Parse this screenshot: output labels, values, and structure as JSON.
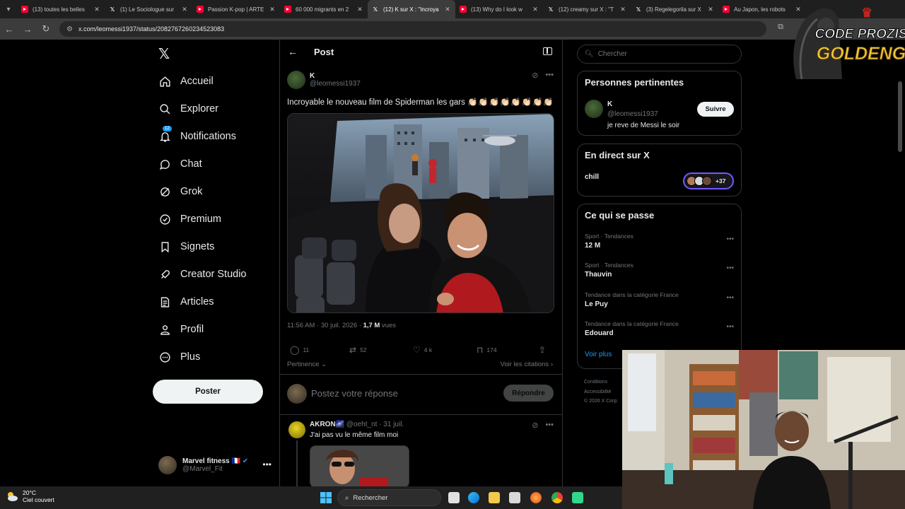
{
  "browser": {
    "tabs": [
      {
        "favicon": "youtube-icon",
        "title": "(13) toutes les belles"
      },
      {
        "favicon": "x-icon",
        "title": "(1) Le Sociologue sur"
      },
      {
        "favicon": "youtube-icon",
        "title": "Passion K-pop | ARTE"
      },
      {
        "favicon": "youtube-icon",
        "title": "60 000 migrants en 2"
      },
      {
        "favicon": "x-icon",
        "title": "(12) K sur X : \"Incroya",
        "active": true
      },
      {
        "favicon": "youtube-icon",
        "title": "(13) Why do I look w"
      },
      {
        "favicon": "x-icon",
        "title": "(12) creamy sur X : \"T"
      },
      {
        "favicon": "x-icon",
        "title": "(3) Regelegorila sur X"
      },
      {
        "favicon": "youtube-icon",
        "title": "Au Japon, les robots"
      }
    ],
    "url": "x.com/leomessi1937/status/2082767260234523083"
  },
  "overlay": {
    "logo_line1": "CODE PROZIS",
    "logo_line2": "GOLDENG"
  },
  "nav": {
    "items": [
      {
        "icon": "home-icon",
        "label": "Accueil"
      },
      {
        "icon": "search-icon",
        "label": "Explorer"
      },
      {
        "icon": "bell-icon",
        "label": "Notifications",
        "badge": "12"
      },
      {
        "icon": "chat-icon",
        "label": "Chat"
      },
      {
        "icon": "grok-icon",
        "label": "Grok"
      },
      {
        "icon": "premium-icon",
        "label": "Premium"
      },
      {
        "icon": "bookmark-icon",
        "label": "Signets"
      },
      {
        "icon": "rocket-icon",
        "label": "Creator Studio"
      },
      {
        "icon": "article-icon",
        "label": "Articles"
      },
      {
        "icon": "profile-icon",
        "label": "Profil"
      },
      {
        "icon": "more-icon",
        "label": "Plus"
      }
    ],
    "post_button": "Poster",
    "account": {
      "name": "Marvel fitness",
      "flag": "🇫🇷",
      "handle": "@Marvel_Fit"
    }
  },
  "post": {
    "header_title": "Post",
    "author_name": "K",
    "author_handle": "@leomessi1937",
    "text": "Incroyable le nouveau film de Spiderman les gars",
    "claps": "👏🏻👏🏻👏🏻👏🏻👏🏻👏🏻👏🏻👏🏻",
    "timestamp": "11:56 AM · 30 juil. 2026 · ",
    "views_count": "1,7 M",
    "views_label": " vues",
    "replies": "11",
    "reposts": "52",
    "likes": "4 k",
    "bookmarks": "174",
    "sort_label": "Pertinence",
    "quotes_link": "Voir les citations",
    "reply_placeholder": "Postez votre réponse",
    "reply_button": "Répondre"
  },
  "reply": {
    "name": "AKRON🌌",
    "handle": "@oeht_nt",
    "date": "· 31 juil.",
    "text": "J'ai pas vu le même film moi"
  },
  "sidebar": {
    "search_placeholder": "Chercher",
    "relevant_title": "Personnes pertinentes",
    "relevant": {
      "name": "K",
      "handle": "@leomessi1937",
      "bio": "je reve de Messi le soir",
      "follow": "Suivre"
    },
    "live_title": "En direct sur X",
    "live_item": "chill",
    "live_count": "+37",
    "trends_title": "Ce qui se passe",
    "trends": [
      {
        "category": "Sport · Tendances",
        "name": "12 M"
      },
      {
        "category": "Sport · Tendances",
        "name": "Thauvin"
      },
      {
        "category": "Tendance dans la catégorie France",
        "name": "Le Puy"
      },
      {
        "category": "Tendance dans la catégorie France",
        "name": "Edouard"
      }
    ],
    "see_more": "Voir plus",
    "footer": [
      "Conditions",
      "Accessibilité",
      "© 2026 X Corp."
    ]
  },
  "taskbar": {
    "temperature": "20°C",
    "condition": "Ciel couvert",
    "search": "Rechercher"
  }
}
